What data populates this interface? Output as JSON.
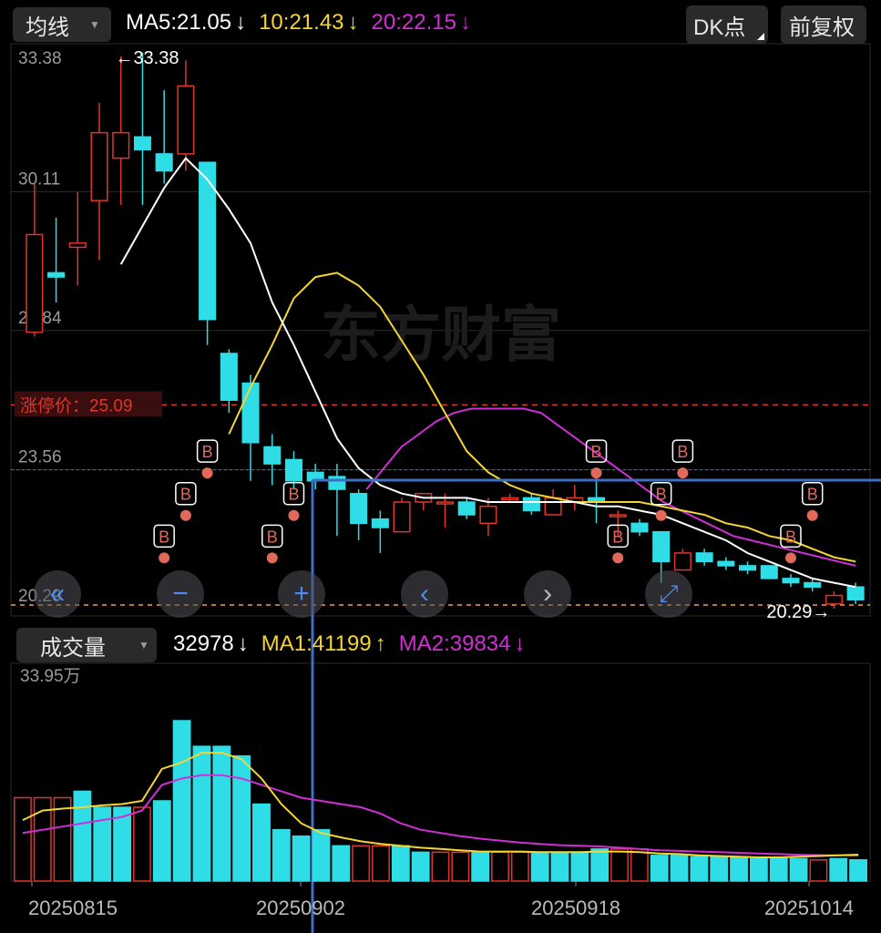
{
  "top_bar": {
    "indicator_select": "均线",
    "ma5": {
      "label": "MA5:",
      "value": "21.05",
      "arrow": "↓",
      "color": "#ffffff"
    },
    "ma10": {
      "label": "10:",
      "value": "21.43",
      "arrow": "↓",
      "color": "#f5d531"
    },
    "ma20": {
      "label": "20:",
      "value": "22.15",
      "arrow": "↓",
      "color": "#d12fd6"
    },
    "dk_button": "DK点",
    "adjust_button": "前复权"
  },
  "price_panel": {
    "y_ticks": [
      "33.38",
      "30.11",
      "26.84",
      "23.56",
      "20.29"
    ],
    "max_label": "←33.38",
    "min_label": "20.29→",
    "limit_up_label": "涨停价：",
    "limit_up_value": "25.09",
    "watermark": "东方财富",
    "buy_marker_text": "B"
  },
  "volume_panel": {
    "indicator_select": "成交量",
    "vol": {
      "value": "32978",
      "arrow": "↓",
      "color": "#ffffff"
    },
    "ma1": {
      "label": "MA1:",
      "value": "41199",
      "arrow": "↑",
      "color": "#f5d531"
    },
    "ma2": {
      "label": "MA2:",
      "value": "39834",
      "arrow": "↓",
      "color": "#d12fd6"
    },
    "y_max_label": "33.95万"
  },
  "x_axis_labels": [
    "20250815",
    "20250902",
    "20250918",
    "20251014"
  ],
  "nav_controls": [
    "double-left-icon",
    "zoom-out-icon",
    "zoom-in-icon",
    "left-icon",
    "right-icon",
    "expand-icon"
  ],
  "colors": {
    "up": "#e0352b",
    "down": "#2fdde6",
    "ma5": "#ffffff",
    "ma10": "#f5d531",
    "ma20": "#d12fd6",
    "crosshair": "#3d6fc7",
    "limit": "#e0352b",
    "b_marker": "#e06a5a"
  },
  "chart_data": [
    {
      "type": "candlestick",
      "title": "",
      "ylim": [
        20.29,
        33.38
      ],
      "x_labels": [
        "20250815",
        "20250902",
        "20250918",
        "20251014"
      ],
      "candles": [
        {
          "o": 26.8,
          "c": 29.1,
          "h": 30.3,
          "l": 26.7
        },
        {
          "o": 28.2,
          "c": 28.1,
          "h": 29.5,
          "l": 27.5
        },
        {
          "o": 28.8,
          "c": 28.9,
          "h": 30.1,
          "l": 27.9
        },
        {
          "o": 29.9,
          "c": 31.5,
          "h": 32.2,
          "l": 28.5
        },
        {
          "o": 30.9,
          "c": 31.5,
          "h": 33.3,
          "l": 29.8
        },
        {
          "o": 31.4,
          "c": 31.1,
          "h": 33.38,
          "l": 29.8
        },
        {
          "o": 31.0,
          "c": 30.6,
          "h": 32.5,
          "l": 30.3
        },
        {
          "o": 31.0,
          "c": 32.6,
          "h": 33.2,
          "l": 30.6
        },
        {
          "o": 30.8,
          "c": 27.1,
          "h": 30.8,
          "l": 26.5
        },
        {
          "o": 26.3,
          "c": 25.2,
          "h": 26.4,
          "l": 24.9
        },
        {
          "o": 25.6,
          "c": 24.2,
          "h": 25.8,
          "l": 23.3
        },
        {
          "o": 24.1,
          "c": 23.7,
          "h": 24.4,
          "l": 23.2
        },
        {
          "o": 23.8,
          "c": 23.3,
          "h": 24.0,
          "l": 23.1
        },
        {
          "o": 23.5,
          "c": 23.3,
          "h": 23.7,
          "l": 23.1
        },
        {
          "o": 23.4,
          "c": 23.1,
          "h": 23.7,
          "l": 22.0
        },
        {
          "o": 23.0,
          "c": 22.3,
          "h": 23.1,
          "l": 21.9
        },
        {
          "o": 22.4,
          "c": 22.2,
          "h": 22.6,
          "l": 21.6
        },
        {
          "o": 22.1,
          "c": 22.8,
          "h": 22.9,
          "l": 22.1
        },
        {
          "o": 22.8,
          "c": 23.0,
          "h": 23.0,
          "l": 22.6
        },
        {
          "o": 22.8,
          "c": 22.8,
          "h": 23.0,
          "l": 22.2
        },
        {
          "o": 22.8,
          "c": 22.5,
          "h": 22.9,
          "l": 22.4
        },
        {
          "o": 22.3,
          "c": 22.7,
          "h": 22.9,
          "l": 22.0
        },
        {
          "o": 22.9,
          "c": 22.9,
          "h": 23.0,
          "l": 22.8
        },
        {
          "o": 22.9,
          "c": 22.6,
          "h": 23.0,
          "l": 22.5
        },
        {
          "o": 22.5,
          "c": 22.9,
          "h": 23.1,
          "l": 22.5
        },
        {
          "o": 22.8,
          "c": 22.9,
          "h": 23.2,
          "l": 22.6
        },
        {
          "o": 22.9,
          "c": 22.8,
          "h": 23.4,
          "l": 22.3
        },
        {
          "o": 22.5,
          "c": 22.5,
          "h": 22.6,
          "l": 22.0
        },
        {
          "o": 22.3,
          "c": 22.1,
          "h": 22.4,
          "l": 22.0
        },
        {
          "o": 22.1,
          "c": 21.4,
          "h": 22.1,
          "l": 20.9
        },
        {
          "o": 21.2,
          "c": 21.6,
          "h": 21.7,
          "l": 21.2
        },
        {
          "o": 21.6,
          "c": 21.4,
          "h": 21.7,
          "l": 21.3
        },
        {
          "o": 21.4,
          "c": 21.3,
          "h": 21.5,
          "l": 21.2
        },
        {
          "o": 21.3,
          "c": 21.2,
          "h": 21.4,
          "l": 21.1
        },
        {
          "o": 21.3,
          "c": 21.0,
          "h": 21.3,
          "l": 21.0
        },
        {
          "o": 21.0,
          "c": 20.9,
          "h": 21.1,
          "l": 20.8
        },
        {
          "o": 20.9,
          "c": 20.8,
          "h": 21.0,
          "l": 20.7
        },
        {
          "o": 20.4,
          "c": 20.6,
          "h": 20.7,
          "l": 20.29
        },
        {
          "o": 20.8,
          "c": 20.5,
          "h": 20.9,
          "l": 20.4
        }
      ],
      "ma5": [
        null,
        null,
        null,
        null,
        28.4,
        29.3,
        30.2,
        30.9,
        30.4,
        29.7,
        28.9,
        27.5,
        26.5,
        25.4,
        24.3,
        23.6,
        23.2,
        23.0,
        22.9,
        22.9,
        22.9,
        22.8,
        22.8,
        22.8,
        22.8,
        22.8,
        22.7,
        22.7,
        22.6,
        22.5,
        22.3,
        22.1,
        21.9,
        21.6,
        21.4,
        21.2,
        21.0,
        20.9,
        20.8
      ],
      "ma10": [
        null,
        null,
        null,
        null,
        null,
        null,
        null,
        null,
        null,
        24.4,
        25.5,
        26.5,
        27.6,
        28.1,
        28.2,
        27.9,
        27.4,
        26.6,
        25.8,
        24.9,
        24.0,
        23.5,
        23.2,
        23.0,
        22.9,
        22.8,
        22.8,
        22.8,
        22.8,
        22.7,
        22.6,
        22.5,
        22.3,
        22.2,
        22.0,
        21.9,
        21.7,
        21.5,
        21.4
      ],
      "ma20": [
        null,
        null,
        null,
        null,
        null,
        null,
        null,
        null,
        null,
        null,
        null,
        null,
        null,
        null,
        null,
        null,
        null,
        null,
        null,
        23.1,
        23.6,
        24.1,
        24.4,
        24.7,
        24.9,
        25.0,
        25.0,
        25.0,
        25.0,
        24.9,
        24.6,
        24.3,
        24.0,
        23.7,
        23.4,
        23.1,
        22.8,
        22.6,
        22.4,
        22.2,
        22.0,
        21.9,
        21.8,
        21.7,
        21.6,
        21.5,
        21.4,
        21.3
      ],
      "buy_markers_count": 11
    },
    {
      "type": "bar",
      "title": "成交量",
      "ylim": [
        0,
        339500
      ],
      "values": [
        130000,
        130000,
        130000,
        140000,
        115000,
        115000,
        115000,
        125000,
        250000,
        210000,
        210000,
        195000,
        120000,
        80000,
        70000,
        80000,
        55000,
        55000,
        55000,
        55000,
        45000,
        45000,
        45000,
        45000,
        45000,
        45000,
        45000,
        45000,
        45000,
        50000,
        50000,
        50000,
        40000,
        40000,
        38000,
        38000,
        38000,
        35000,
        35000,
        35000,
        32978,
        35000,
        32978
      ],
      "up": [
        true,
        true,
        true,
        false,
        false,
        false,
        true,
        false,
        false,
        false,
        false,
        false,
        false,
        false,
        false,
        false,
        false,
        true,
        true,
        false,
        false,
        true,
        true,
        false,
        true,
        true,
        false,
        false,
        false,
        false,
        true,
        true,
        false,
        false,
        false,
        false,
        false,
        false,
        false,
        false,
        true,
        false,
        false
      ],
      "ma1": [
        95000,
        110000,
        113000,
        115000,
        118000,
        120000,
        125000,
        175000,
        185000,
        200000,
        200000,
        190000,
        160000,
        120000,
        90000,
        75000,
        68000,
        62000,
        58000,
        55000,
        52000,
        50000,
        48000,
        46000,
        46000,
        46000,
        45000,
        45000,
        45000,
        46000,
        46000,
        45000,
        43000,
        42000,
        40000,
        39000,
        38000,
        37000,
        37000,
        38000,
        39000,
        40000,
        41199
      ],
      "ma2": [
        75000,
        80000,
        85000,
        90000,
        95000,
        100000,
        110000,
        150000,
        160000,
        165000,
        165000,
        160000,
        150000,
        140000,
        130000,
        125000,
        120000,
        115000,
        105000,
        90000,
        80000,
        75000,
        70000,
        66000,
        63000,
        60000,
        58000,
        56000,
        55000,
        54000,
        52000,
        50000,
        48000,
        47000,
        46000,
        45000,
        44000,
        43000,
        42000,
        41000,
        40500,
        40000,
        39834
      ]
    }
  ]
}
